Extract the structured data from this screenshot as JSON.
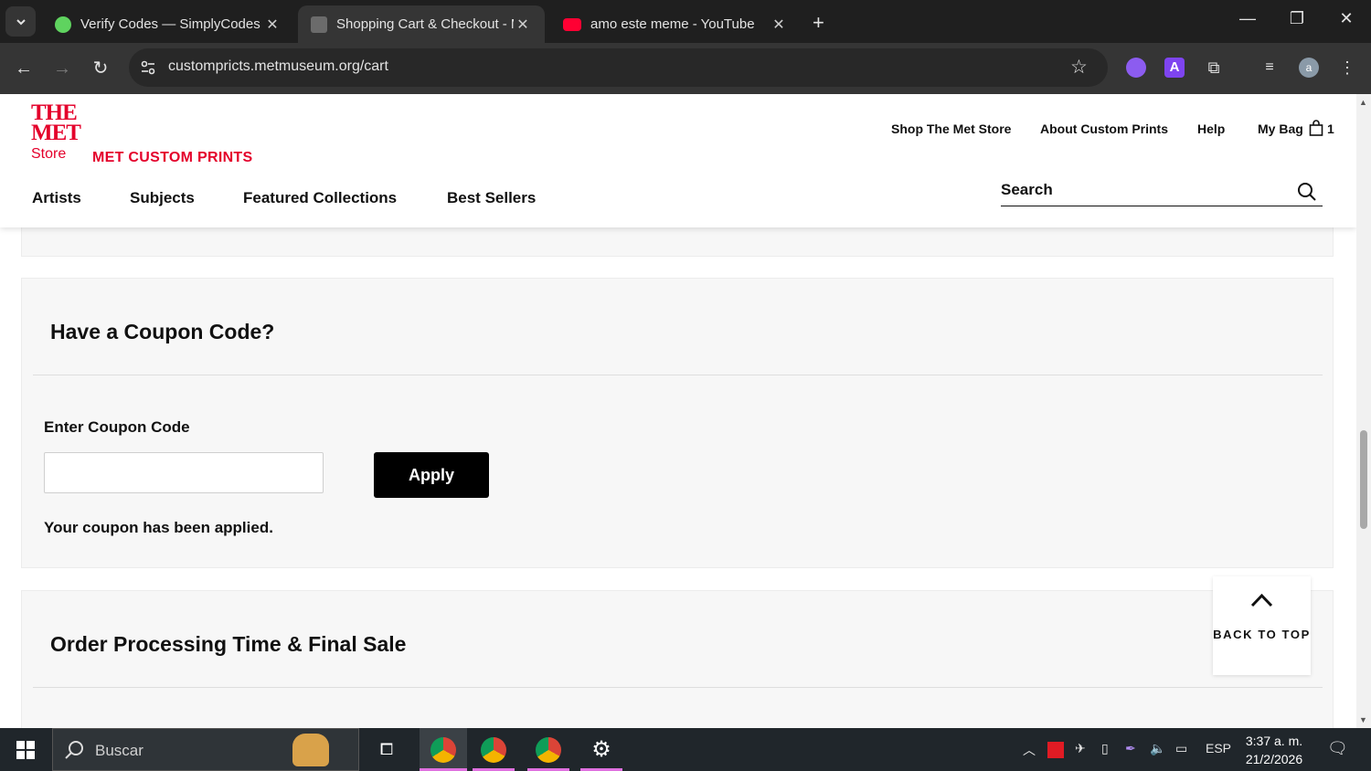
{
  "browser": {
    "tabs": [
      {
        "title": "Verify Codes — SimplyCodes",
        "favicon": "simplycodes-icon",
        "color": "#5fd35f"
      },
      {
        "title": "Shopping Cart & Checkout - Met",
        "favicon": "met-icon",
        "color": "#6b6b6b"
      },
      {
        "title": "amo este meme - YouTube",
        "favicon": "youtube-icon",
        "color": "#ff0033"
      }
    ],
    "url": "custompricts.metmuseum.org/cart"
  },
  "site": {
    "logo_line1": "THE",
    "logo_line2": "MET",
    "logo_line3": "Store",
    "brand": "MET CUSTOM PRINTS",
    "top_links": [
      "Shop The Met Store",
      "About Custom Prints",
      "Help",
      "My Bag"
    ],
    "bag_count": "1",
    "main_nav": [
      "Artists",
      "Subjects",
      "Featured Collections",
      "Best Sellers"
    ],
    "search_placeholder": "Search"
  },
  "coupon": {
    "title": "Have a Coupon Code?",
    "label": "Enter Coupon Code",
    "value": "",
    "button": "Apply",
    "message": "Your coupon has been applied."
  },
  "order": {
    "title": "Order Processing Time & Final Sale"
  },
  "back_to_top": "BACK TO TOP",
  "taskbar": {
    "search": "Buscar",
    "lang": "ESP",
    "time": "3:37 a. m.",
    "date": "21/2/2026"
  }
}
